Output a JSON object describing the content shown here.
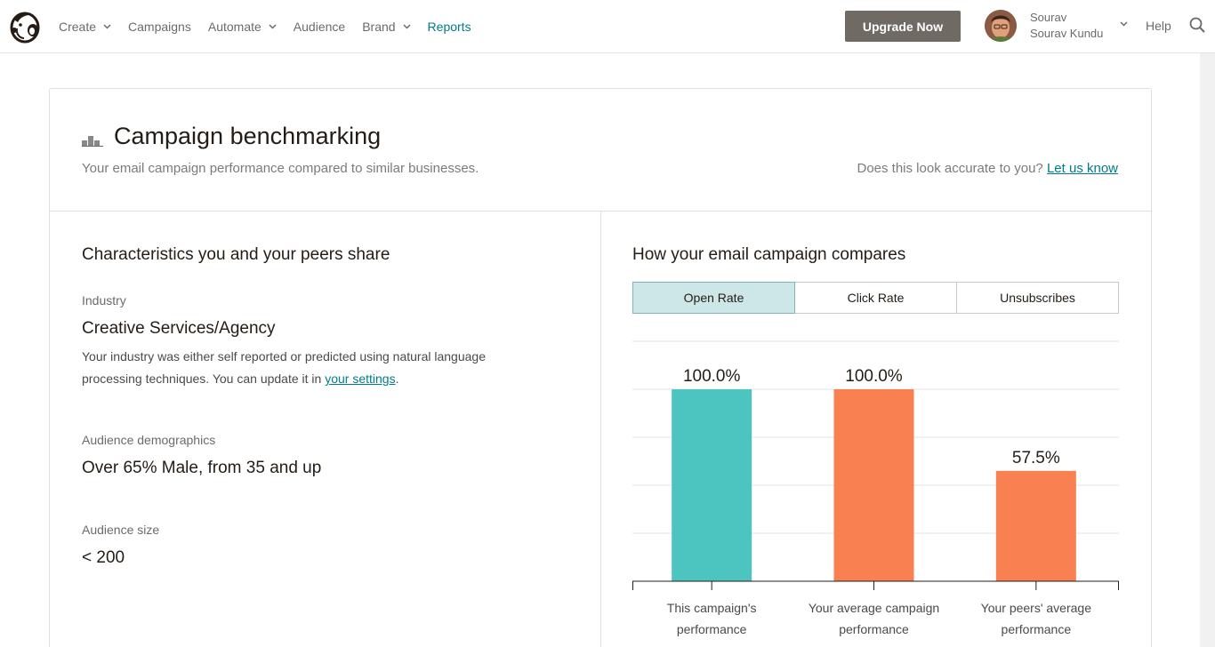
{
  "nav": {
    "items": [
      {
        "label": "Create",
        "has_dropdown": true,
        "active": false
      },
      {
        "label": "Campaigns",
        "has_dropdown": false,
        "active": false
      },
      {
        "label": "Automate",
        "has_dropdown": true,
        "active": false
      },
      {
        "label": "Audience",
        "has_dropdown": false,
        "active": false
      },
      {
        "label": "Brand",
        "has_dropdown": true,
        "active": false
      },
      {
        "label": "Reports",
        "has_dropdown": false,
        "active": true
      }
    ],
    "upgrade_label": "Upgrade Now",
    "user": {
      "first_name": "Sourav",
      "full_name": "Sourav Kundu"
    },
    "help_label": "Help",
    "icons": {
      "logo": "mailchimp-freddie-icon",
      "search": "search-icon",
      "dropdown": "chevron-down-icon"
    }
  },
  "colors": {
    "accent": "#007c89",
    "upgrade_bg": "#6f6a63",
    "campaign_bar": "#4cc4c0",
    "comparison_bar": "#f98051",
    "active_tab": "#cde6e8"
  },
  "header": {
    "title": "Campaign benchmarking",
    "subtitle": "Your email campaign performance compared to similar businesses.",
    "accuracy_prompt": "Does this look accurate to you?",
    "accuracy_link": "Let us know"
  },
  "characteristics": {
    "title": "Characteristics you and your peers share",
    "industry_label": "Industry",
    "industry_value": "Creative Services/Agency",
    "industry_note": "Your industry was either self reported or predicted using natural language processing techniques. You can update it in",
    "industry_note_link": "your settings",
    "industry_note_end": ".",
    "demographics_label": "Audience demographics",
    "demographics_value": "Over 65% Male, from 35 and up",
    "size_label": "Audience size",
    "size_value": "< 200"
  },
  "comparison": {
    "title": "How your email campaign compares",
    "tabs": [
      {
        "label": "Open Rate",
        "active": true
      },
      {
        "label": "Click Rate",
        "active": false
      },
      {
        "label": "Unsubscribes",
        "active": false
      }
    ]
  },
  "chart_data": {
    "type": "bar",
    "categories": [
      "This campaign's performance",
      "Your average campaign performance",
      "Your peers' average performance"
    ],
    "category_lines": [
      [
        "This campaign's",
        "performance"
      ],
      [
        "Your average campaign",
        "performance"
      ],
      [
        "Your peers' average",
        "performance"
      ]
    ],
    "values": [
      100.0,
      100.0,
      57.5
    ],
    "data_labels": [
      "100.0%",
      "100.0%",
      "57.5%"
    ],
    "bar_colors": [
      "#4cc4c0",
      "#f98051",
      "#f98051"
    ],
    "ylim": [
      0,
      125
    ],
    "grid": true,
    "title": "",
    "xlabel": "",
    "ylabel": ""
  }
}
